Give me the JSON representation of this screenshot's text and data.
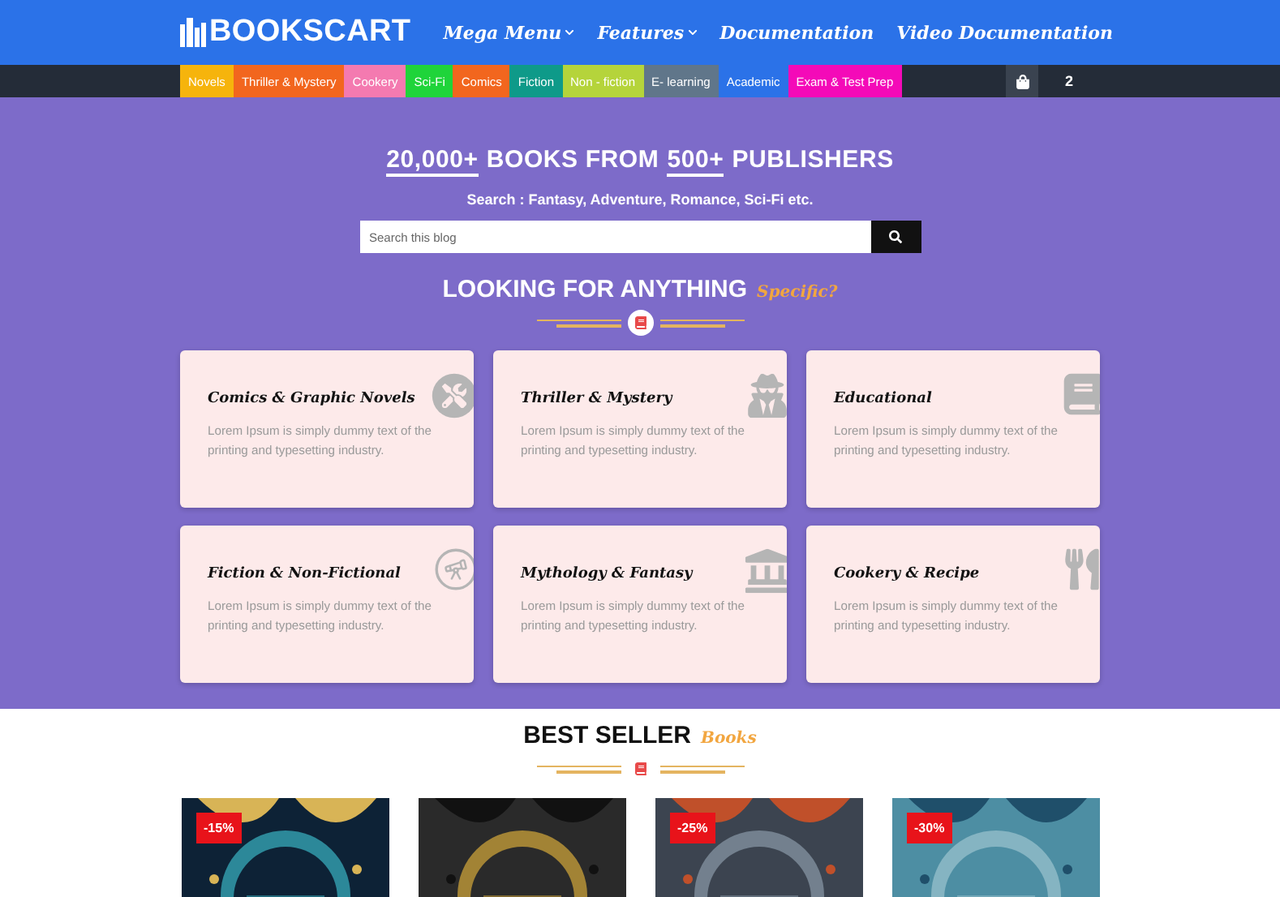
{
  "header": {
    "logo": "BOOKSCART",
    "menu": [
      {
        "label": "Mega Menu",
        "dropdown": true
      },
      {
        "label": "Features",
        "dropdown": true
      },
      {
        "label": "Documentation",
        "dropdown": false
      },
      {
        "label": "Video Documentation",
        "dropdown": false
      }
    ]
  },
  "categories": [
    {
      "label": "Novels",
      "color": "#f6b40c"
    },
    {
      "label": "Thriller & Mystery",
      "color": "#f2661e"
    },
    {
      "label": "Cookery",
      "color": "#f47ab0"
    },
    {
      "label": "Sci-Fi",
      "color": "#1fd43a"
    },
    {
      "label": "Comics",
      "color": "#f2661e"
    },
    {
      "label": "Fiction",
      "color": "#0e9a89"
    },
    {
      "label": "Non - fiction",
      "color": "#b5d43b"
    },
    {
      "label": "E- learning",
      "color": "#60768a"
    },
    {
      "label": "Academic",
      "color": "#2b72e8"
    },
    {
      "label": "Exam & Test Prep",
      "color": "#f40ab8"
    }
  ],
  "cart": {
    "count": "2"
  },
  "hero": {
    "title": [
      {
        "text": "20,000+",
        "underlined": true
      },
      {
        "text": "BOOKS FROM",
        "underlined": false
      },
      {
        "text": "500+",
        "underlined": true
      },
      {
        "text": "PUBLISHERS",
        "underlined": false
      }
    ],
    "subtitle": "Search : Fantasy, Adventure, Romance, Sci-Fi etc.",
    "search": {
      "placeholder": "Search this blog"
    },
    "heading": "LOOKING FOR ANYTHING",
    "heading_accent": "Specific?"
  },
  "cards": [
    {
      "title": "Comics & Graphic Novels",
      "text": "Lorem Ipsum is simply dummy text of the printing and typesetting industry.",
      "kind": "tools"
    },
    {
      "title": "Thriller & Mystery",
      "text": "Lorem Ipsum is simply dummy text of the printing and typesetting industry.",
      "kind": "spy"
    },
    {
      "title": "Educational",
      "text": "Lorem Ipsum is simply dummy text of the printing and typesetting industry.",
      "kind": "book"
    },
    {
      "title": "Fiction & Non-Fictional",
      "text": "Lorem Ipsum is simply dummy text of the printing and typesetting industry.",
      "kind": "telescope"
    },
    {
      "title": "Mythology & Fantasy",
      "text": "Lorem Ipsum is simply dummy text of the printing and typesetting industry.",
      "kind": "temple"
    },
    {
      "title": "Cookery & Recipe",
      "text": "Lorem Ipsum is simply dummy text of the printing and typesetting industry.",
      "kind": "utensils"
    }
  ],
  "best_seller": {
    "heading": "BEST SELLER",
    "heading_accent": "Books",
    "books": [
      {
        "kind": "picture",
        "discount": "-15%"
      },
      {
        "kind": "picture"
      },
      {
        "kind": "picture",
        "discount": "-25%"
      },
      {
        "kind": "picture",
        "discount": "-30%"
      }
    ]
  }
}
